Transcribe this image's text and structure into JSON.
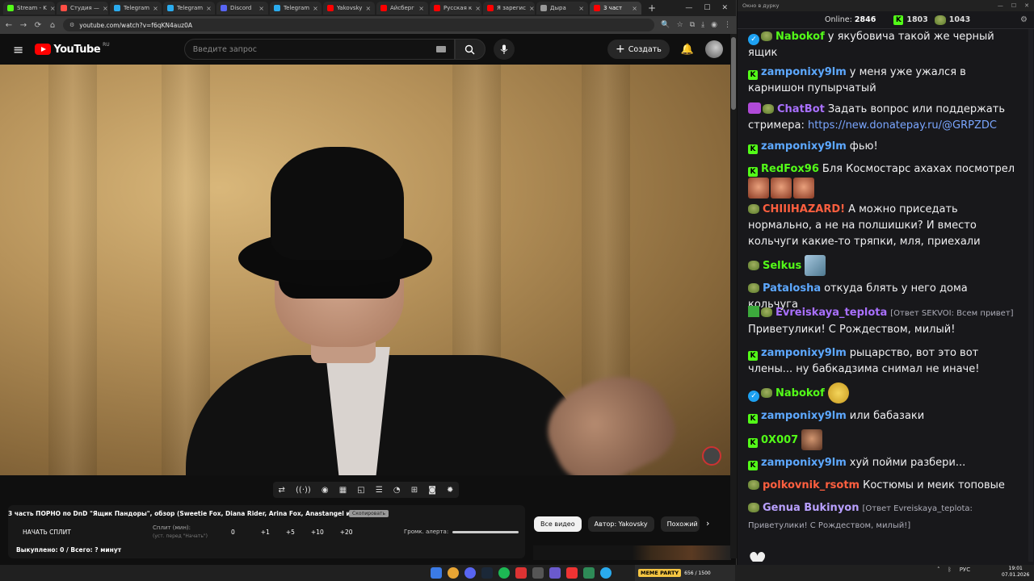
{
  "browser": {
    "tabs": [
      {
        "label": "Stream - K",
        "color": "#53fc18"
      },
      {
        "label": "Студия —",
        "color": "#ff4e45"
      },
      {
        "label": "Telegram",
        "color": "#2aabee"
      },
      {
        "label": "Telegram",
        "color": "#2aabee"
      },
      {
        "label": "Discord",
        "color": "#5865f2"
      },
      {
        "label": "Telegram",
        "color": "#2aabee"
      },
      {
        "label": "Yakovsky",
        "color": "#ff0000"
      },
      {
        "label": "Айсберг",
        "color": "#ff0000"
      },
      {
        "label": "Русская к",
        "color": "#ff0000"
      },
      {
        "label": "Я зарегис",
        "color": "#ff0000"
      },
      {
        "label": "Дыра",
        "color": "#999999"
      },
      {
        "label": "3 част",
        "color": "#ff0000",
        "active": true
      }
    ],
    "url": "youtube.com/watch?v=f6qKN4auz0A"
  },
  "youtube": {
    "logo_text": "YouTube",
    "region": "RU",
    "search_placeholder": "Введите запрос",
    "create_label": "Создать"
  },
  "video": {
    "title": "3 часть ПОРНО по DnD \"Ящик Пандоры\", обзор (Sweetie Fox, Diana Rider, Arina Fox, Anastangel и др)",
    "tag": "Скопировать",
    "split_button": "НАЧАТЬ СПЛИТ",
    "split_label": "Сплит (мин):",
    "split_sub": "(уст. перед \"Начать\")",
    "split_values": [
      "0",
      "+1",
      "+5",
      "+10",
      "+20"
    ],
    "volume_label": "Громк. алерта:",
    "bought_text": "Выкуплено: 0 / Всего: ? минут"
  },
  "chips": [
    "Все видео",
    "Автор: Yakovsky",
    "Похожий"
  ],
  "chat": {
    "window_title": "Окно в дурку",
    "online_label": "Online:",
    "online_count": "2846",
    "kick_count": "1803",
    "pepe_count": "1043",
    "messages": [
      {
        "user": "Nabokof",
        "color": "#53fc18",
        "text": "у якубовича такой же черный ящик",
        "badges": [
          "verified",
          "pepe"
        ]
      },
      {
        "user": "zamponixy9lm",
        "color": "#5da8ff",
        "text": "у меня уже ужался в карнишон пупырчатый",
        "badges": [
          "kick"
        ]
      },
      {
        "user": "ChatBot",
        "color": "#a970ff",
        "text": "Задать вопрос или поддержать стримера:",
        "link": "https://new.donatepay.ru/@GRPZDC",
        "badges": [
          "bot",
          "pepe"
        ]
      },
      {
        "user": "zamponixy9lm",
        "color": "#5da8ff",
        "text": "фью!",
        "badges": [
          "kick"
        ]
      },
      {
        "user": "RedFox96",
        "color": "#53fc18",
        "text": "Бля Космостарс ахахах посмотрел",
        "badges": [
          "kick"
        ]
      },
      {
        "user": "CHIIIHAZARD!",
        "color": "#ff5f3f",
        "text": "А можно приседать нормально, а не на полшишки? И вместо кольчуги какие-то тряпки, мля, приехали",
        "badges": [
          "pepe"
        ]
      },
      {
        "user": "Selkus",
        "color": "#53fc18",
        "text": "",
        "badges": [
          "pepe"
        ]
      },
      {
        "user": "Patalosha",
        "color": "#5da8ff",
        "text": "откуда блять у него дома кольчуга",
        "badges": [
          "pepe"
        ]
      },
      {
        "user": "Evreiskaya_teplota",
        "color": "#a970ff",
        "reply": "[Ответ SEKVOI: Всем привет]",
        "text": "Приветулики! С Рождеством, милый!",
        "badges": [
          "mod",
          "pepe"
        ]
      },
      {
        "user": "zamponixy9lm",
        "color": "#5da8ff",
        "text": "рыцарство, вот это вот члены... ну бабкадзима снимал не иначе!",
        "badges": [
          "kick"
        ]
      },
      {
        "user": "Nabokof",
        "color": "#53fc18",
        "text": "",
        "badges": [
          "verified",
          "pepe"
        ]
      },
      {
        "user": "zamponixy9lm",
        "color": "#5da8ff",
        "text": "или бабазаки",
        "badges": [
          "kick"
        ]
      },
      {
        "user": "0X007",
        "color": "#53fc18",
        "text": "",
        "badges": [
          "kick"
        ]
      },
      {
        "user": "zamponixy9lm",
        "color": "#5da8ff",
        "text": "хуй пойми разбери...",
        "badges": [
          "kick"
        ]
      },
      {
        "user": "polkovnik_rsotm",
        "color": "#ff5f3f",
        "text": "Костюмы и меик топовые",
        "badges": [
          "pepe"
        ]
      },
      {
        "user": "Genua Bukinyon",
        "color": "#b9a0ff",
        "reply": "[Ответ Evreiskaya_teplota: Приветулики! С Рождеством, милый!]",
        "text": "",
        "badges": [
          "pepe"
        ]
      }
    ]
  },
  "taskbar": {
    "game_label": "MEME PARTY",
    "game_counter": "656 / 1500",
    "lang": "РУС",
    "time": "19:01",
    "date": "07.01.2026"
  }
}
